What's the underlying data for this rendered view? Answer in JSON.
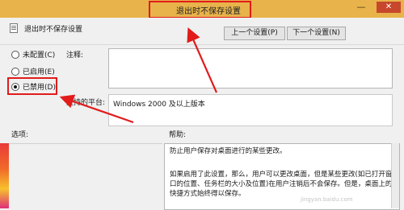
{
  "window": {
    "title": "退出时不保存设置",
    "minimize_glyph": "—",
    "close_glyph": "✕"
  },
  "header": {
    "title": "退出时不保存设置",
    "prev_button": "上一个设置(P)",
    "next_button": "下一个设置(N)"
  },
  "radios": [
    {
      "label": "未配置(C)",
      "checked": false
    },
    {
      "label": "已启用(E)",
      "checked": false
    },
    {
      "label": "已禁用(D)",
      "checked": true
    }
  ],
  "labels": {
    "comment": "注释:",
    "platform": "支持的平台:",
    "options": "选项:",
    "help": "帮助:"
  },
  "platform": "Windows 2000 及以上版本",
  "help": {
    "line1": "防止用户保存对桌面进行的某些更改。",
    "line2": "如果启用了此设置，那么，用户可以更改桌面，但是某些更改(如已打开窗口的位置、任务栏的大小及位置)在用户注销后不会保存。但是，桌面上的快捷方式始终得以保存。"
  },
  "watermark": "jingyan.baidu.com",
  "colors": {
    "titlebar": "#e8b34a",
    "annotation": "#e21b1b"
  }
}
